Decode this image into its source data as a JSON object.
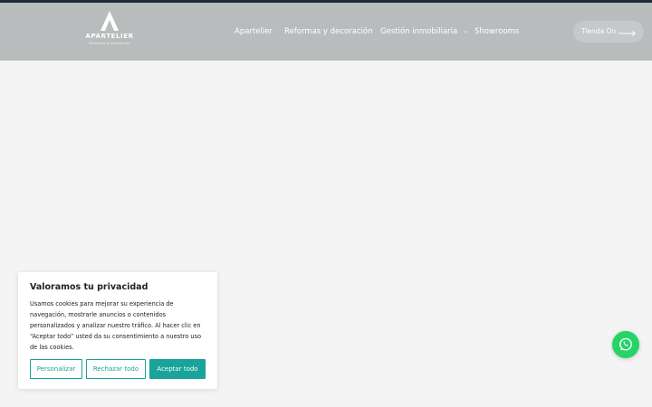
{
  "header": {
    "logo": {
      "name": "APARTELIER",
      "tagline": "Reformas & Decoración"
    },
    "nav": [
      {
        "label": "Apartelier"
      },
      {
        "label": "Reformas y decoración"
      },
      {
        "label": "Gestión inmobiliaria",
        "has_dropdown": true
      },
      {
        "label": "Showrooms"
      }
    ],
    "store_button": {
      "label": "Tienda On"
    }
  },
  "cookie_banner": {
    "title": "Valoramos tu privacidad",
    "body": "Usamos cookies para mejorar su experiencia de navegación, mostrarle anuncios o contenidos personalizados y analizar nuestro tráfico. Al hacer clic en “Aceptar todo” usted da su consentimiento a nuestro uso de las cookies.",
    "buttons": {
      "customize": "Personalizar",
      "reject": "Rechazar todo",
      "accept": "Aceptar todo"
    }
  },
  "colors": {
    "topbar": "#1f2a36",
    "header_bg": "#b9bcbd",
    "accent": "#1aa39a",
    "whatsapp": "#25d366"
  },
  "icons": {
    "logo": "triangle-a-logo-icon",
    "dropdown": "chevron-down-icon",
    "store_arrow": "long-arrow-right-icon",
    "chat": "whatsapp-icon"
  }
}
